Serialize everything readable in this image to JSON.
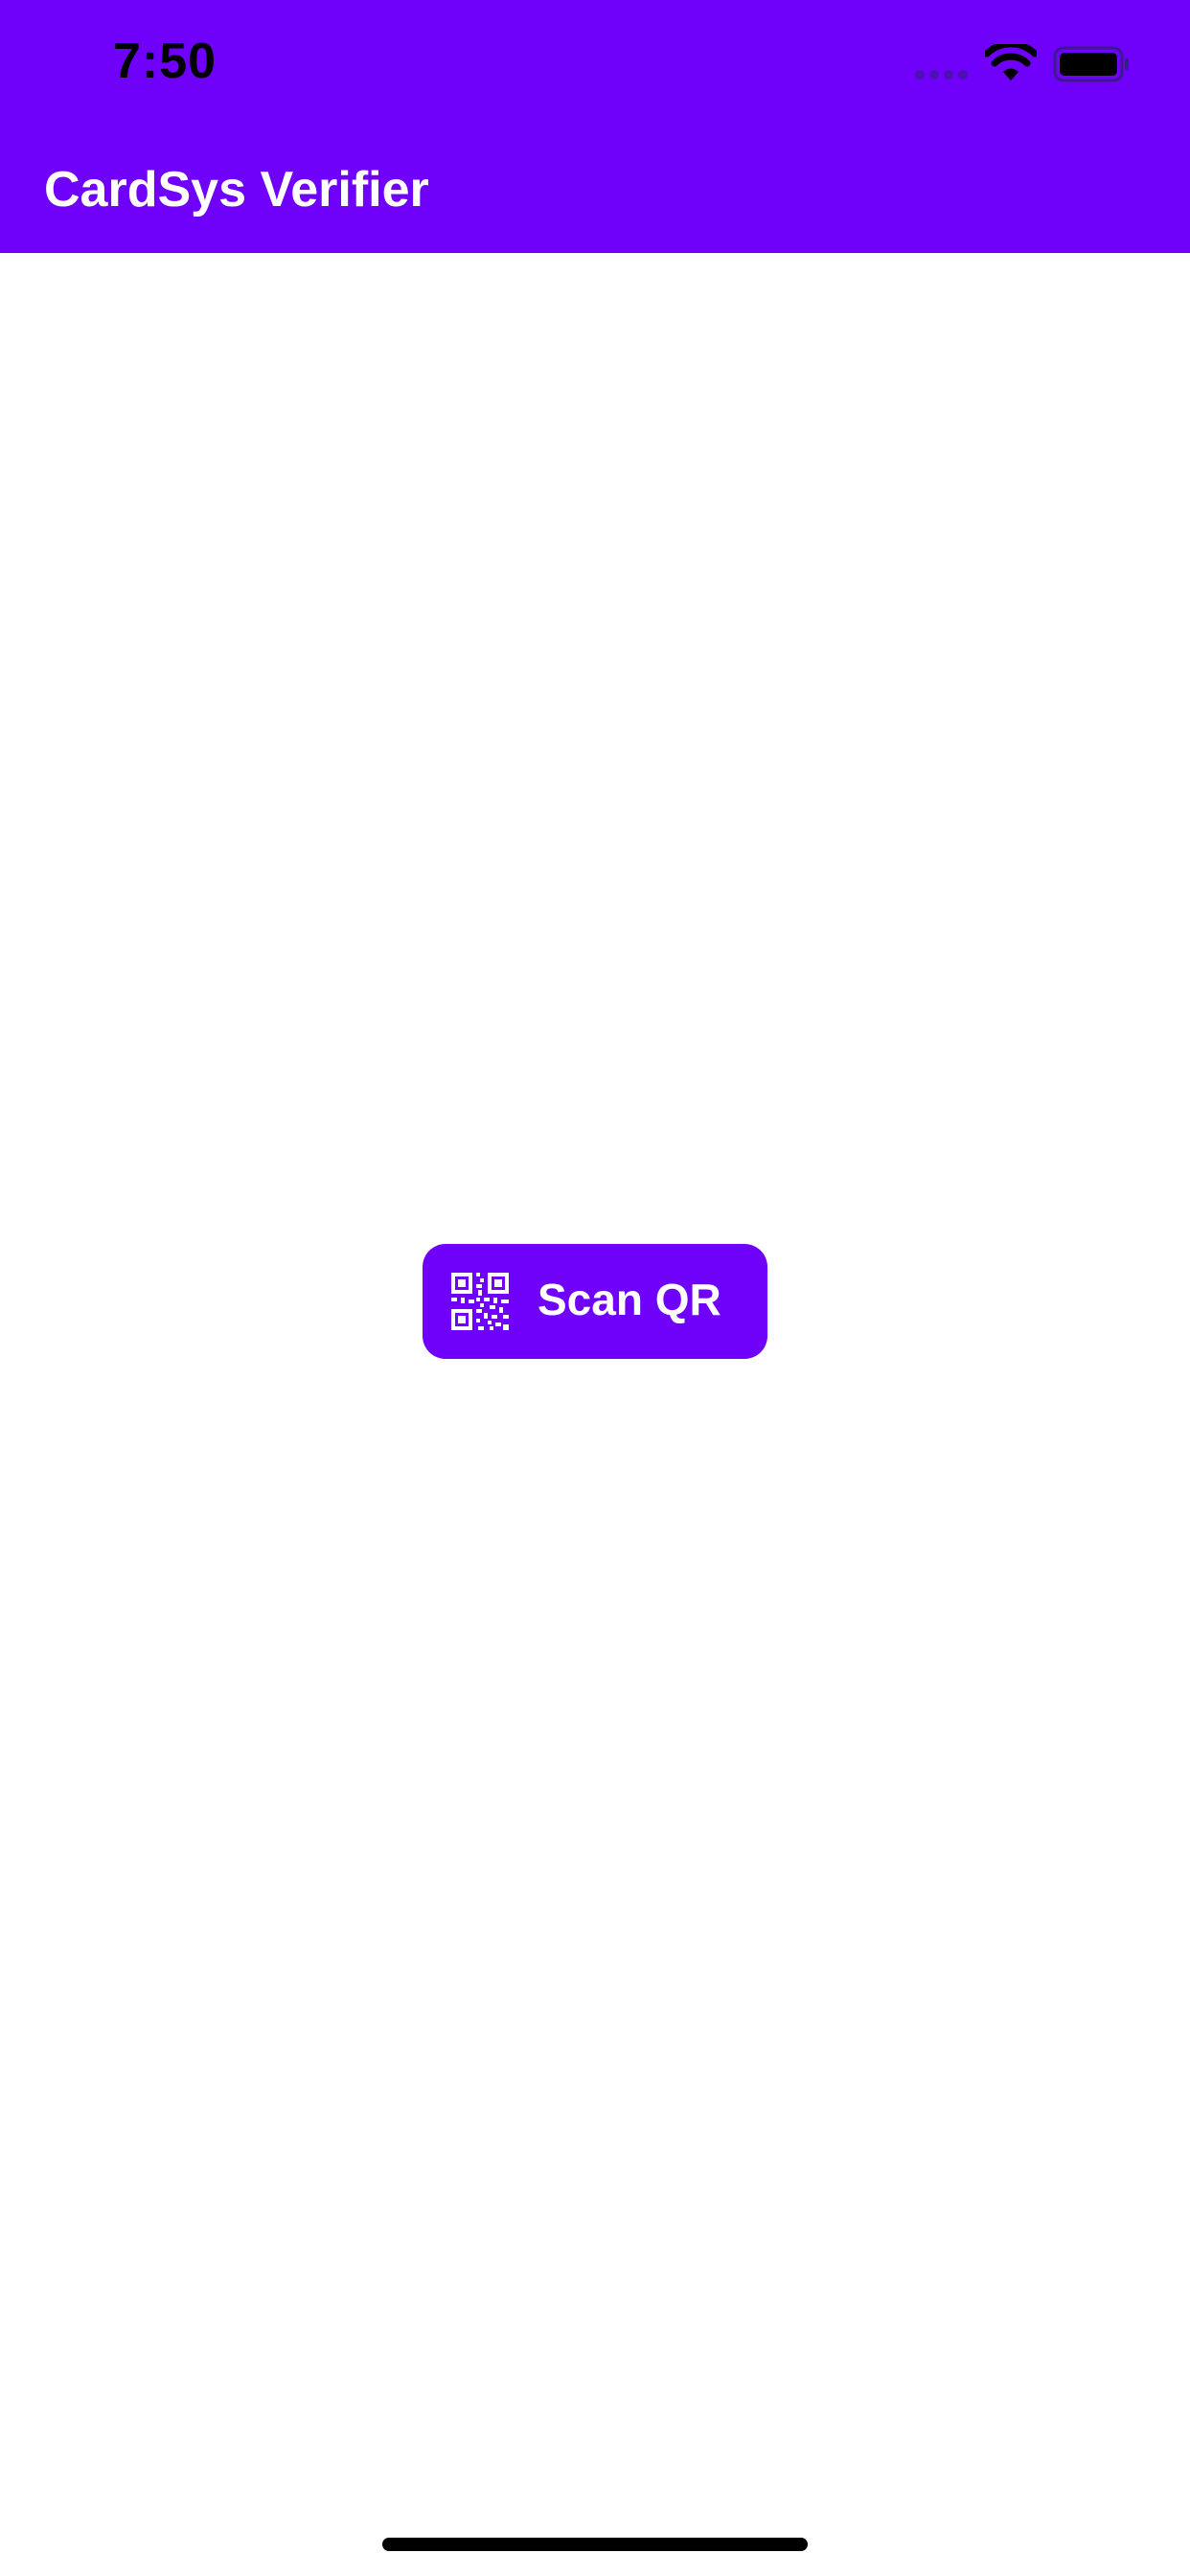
{
  "status_bar": {
    "time": "7:50",
    "wifi_icon": "wifi-icon",
    "battery_icon": "battery-icon"
  },
  "nav_bar": {
    "title": "CardSys Verifier"
  },
  "main": {
    "scan_button": {
      "label": "Scan QR",
      "icon": "qr-code-icon"
    }
  },
  "colors": {
    "brand": "#6f00f9",
    "background": "#ffffff",
    "on_brand": "#ffffff"
  }
}
